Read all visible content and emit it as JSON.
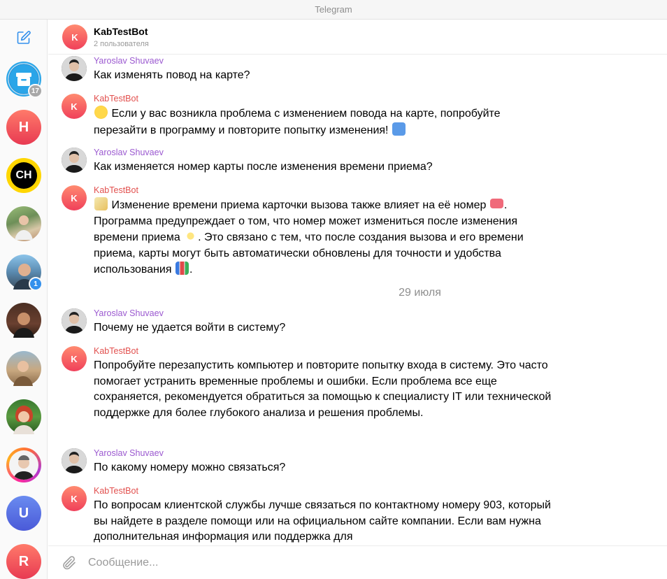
{
  "window": {
    "title": "Telegram"
  },
  "sidebar": {
    "chats": [
      {
        "type": "archive",
        "badge": "17",
        "colors": [
          "#2aa5e8",
          "#1b7fc4"
        ]
      },
      {
        "letter": "H",
        "colors": [
          "#ff7a6a",
          "#e83a52"
        ]
      },
      {
        "letter": "CH",
        "colors": [
          "#ffe000",
          "#ffcc00"
        ]
      },
      {
        "type": "photo",
        "colors": [
          "#7fa06a",
          "#c8b89a"
        ]
      },
      {
        "type": "photo",
        "badge": "1",
        "colors": [
          "#6fb0e0",
          "#3d5a7a"
        ]
      },
      {
        "type": "photo",
        "colors": [
          "#5a3a2a",
          "#c08a60"
        ]
      },
      {
        "type": "photo",
        "colors": [
          "#8ab0c8",
          "#d8b080"
        ]
      },
      {
        "type": "photo",
        "colors": [
          "#3a7a30",
          "#c84a2a"
        ]
      },
      {
        "type": "photo",
        "colors": [
          "#ff3aa0",
          "#ffb020"
        ]
      },
      {
        "letter": "U",
        "colors": [
          "#6a8cf0",
          "#4a5ad8"
        ]
      },
      {
        "letter": "R",
        "colors": [
          "#ff7a6a",
          "#e83a52"
        ]
      }
    ],
    "badge_color": "#3390ec",
    "badge_muted_color": "#a8a8a8"
  },
  "header": {
    "avatar_letter": "K",
    "title": "KabTestBot",
    "subtitle": "2 пользователя"
  },
  "messages": [
    {
      "sender": "Yaroslav Shuvaev",
      "kind": "user",
      "text": "Как изменять повод на карте?"
    },
    {
      "sender": "KabTestBot",
      "kind": "bot",
      "parts": [
        {
          "emoji": "thinking"
        },
        {
          "text": " Если у вас возникла проблема с изменением повода на карте, попробуйте перезайти в программу и повторите попытку изменения! "
        },
        {
          "emoji": "repeat"
        }
      ]
    },
    {
      "sender": "Yaroslav Shuvaev",
      "kind": "user",
      "text": "Как изменяется номер карты после изменения времени приема?"
    },
    {
      "sender": "KabTestBot",
      "kind": "bot",
      "parts": [
        {
          "emoji": "memo"
        },
        {
          "text": " Изменение времени приема карточки вызова также влияет на её номер "
        },
        {
          "emoji": "ticket"
        },
        {
          "text": ". Программа предупреждает о том, что номер может измениться после изменения времени приема "
        },
        {
          "emoji": "sparkles"
        },
        {
          "text": ". Это связано с тем, что после создания вызова и его времени приема, карты могут быть автоматически обновлены для точности и удобства использования "
        },
        {
          "emoji": "chart"
        },
        {
          "text": "."
        }
      ]
    },
    {
      "sender": "Yaroslav Shuvaev",
      "kind": "user",
      "text": "Почему не удается войти в систему?"
    },
    {
      "sender": "KabTestBot",
      "kind": "bot",
      "text": "Попробуйте перезапустить компьютер и повторите попытку входа в систему. Это часто помогает устранить временные проблемы и ошибки. Если проблема все еще сохраняется, рекомендуется обратиться за помощью к специалисту IT или технической поддержке для более глубокого анализа и решения проблемы."
    },
    {
      "sender": "Yaroslav Shuvaev",
      "kind": "user",
      "text": "По какому номеру можно связаться?"
    },
    {
      "sender": "KabTestBot",
      "kind": "bot",
      "text": "По вопросам клиентской службы лучше связаться по контактному номеру 903, который вы найдете в разделе помощи или на официальном сайте компании. Если вам нужна дополнительная информация или поддержка для"
    }
  ],
  "date_separator": "29 июля",
  "bot_avatar_letter": "K",
  "composer": {
    "placeholder": "Сообщение..."
  },
  "colors": {
    "user_name": "#9b59d0",
    "bot_name": "#e2514f",
    "accent": "#3390ec"
  }
}
